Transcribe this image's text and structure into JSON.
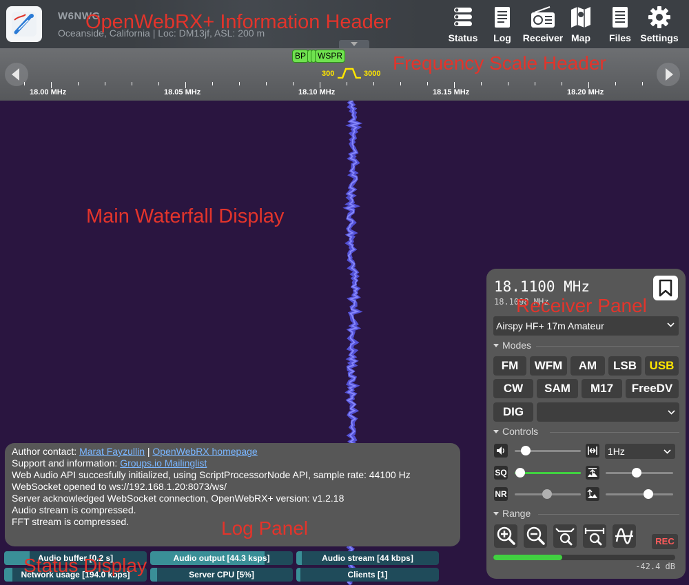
{
  "header": {
    "receiver_name": "W6NWG",
    "location": "Oceanside, California | Loc: DM13jf, ASL: 200 m",
    "annotation": "OpenWebRX+ Information Header",
    "buttons": [
      {
        "label": "Status",
        "icon": "status-icon"
      },
      {
        "label": "Log",
        "icon": "log-icon"
      },
      {
        "label": "Receiver",
        "icon": "receiver-icon"
      },
      {
        "label": "Map",
        "icon": "map-icon"
      },
      {
        "label": "Files",
        "icon": "files-icon"
      },
      {
        "label": "Settings",
        "icon": "settings-icon"
      }
    ]
  },
  "scale": {
    "annotation": "Frequency Scale Header",
    "labels": [
      "18.00 MHz",
      "18.05 MHz",
      "18.10 MHz",
      "18.15 MHz",
      "18.20 MHz"
    ],
    "bookmarks": [
      "BP",
      "WSPR"
    ],
    "filter_low": "300",
    "filter_high": "3000"
  },
  "waterfall": {
    "annotation": "Main Waterfall Display"
  },
  "log": {
    "annotation": "Log Panel",
    "author_prefix": "Author contact: ",
    "author_link": "Marat Fayzullin",
    "author_sep": " | ",
    "homepage_link": "OpenWebRX homepage",
    "support_prefix": "Support and information: ",
    "support_link": "Groups.io Mailinglist",
    "lines": [
      "Web Audio API succesfully initialized, using ScriptProcessorNode API, sample rate: 44100 Hz",
      "WebSocket opened to ws://192.168.1.20:8073/ws/",
      "Server acknowledged WebSocket connection, OpenWebRX+ version: v1.2.18",
      "Audio stream is compressed.",
      "FFT stream is compressed."
    ]
  },
  "status": {
    "annotation": "Status Display",
    "audio_buffer": "Audio buffer [0.2 s]",
    "audio_output": "Audio output [44.3 ksps]",
    "audio_stream": "Audio stream [44 kbps]",
    "network_usage": "Network usage [194.0 kbps]",
    "server_cpu": "Server CPU [5%]",
    "clients": "Clients [1]"
  },
  "receiver": {
    "annotation": "Receiver Panel",
    "frequency": "18.1100 MHz",
    "sub_frequency": "18.1098 MHz",
    "profile": "Airspy HF+ 17m Amateur",
    "modes_title": "Modes",
    "modes": [
      "FM",
      "WFM",
      "AM",
      "LSB",
      "USB",
      "CW",
      "SAM",
      "M17",
      "FreeDV",
      "DIG"
    ],
    "active_mode": "USB",
    "controls_title": "Controls",
    "volume_icon": "speaker-icon",
    "squelch_label": "SQ",
    "nr_label": "NR",
    "tuning_step": "1Hz",
    "range_title": "Range",
    "rec_label": "REC",
    "smeter_db": "-42.4 dB"
  }
}
